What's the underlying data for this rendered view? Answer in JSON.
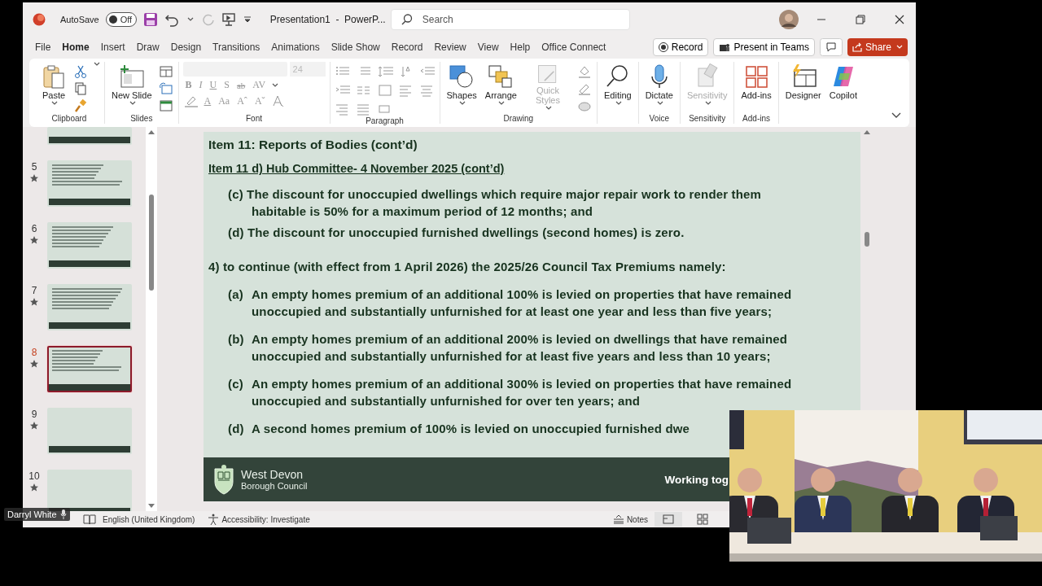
{
  "title_bar": {
    "autosave_label": "AutoSave",
    "autosave_toggle": {
      "label": "Off",
      "on": false
    },
    "document_title": "Presentation1  -  PowerP...",
    "search": {
      "placeholder": "Search"
    }
  },
  "tabs": [
    {
      "label": "File",
      "selected": false
    },
    {
      "label": "Home",
      "selected": true
    },
    {
      "label": "Insert",
      "selected": false
    },
    {
      "label": "Draw",
      "selected": false
    },
    {
      "label": "Design",
      "selected": false
    },
    {
      "label": "Transitions",
      "selected": false
    },
    {
      "label": "Animations",
      "selected": false
    },
    {
      "label": "Slide Show",
      "selected": false
    },
    {
      "label": "Record",
      "selected": false
    },
    {
      "label": "Review",
      "selected": false
    },
    {
      "label": "View",
      "selected": false
    },
    {
      "label": "Help",
      "selected": false
    },
    {
      "label": "Office Connect",
      "selected": false
    }
  ],
  "tab_actions": {
    "record": "Record",
    "present": "Present in Teams",
    "share": "Share"
  },
  "ribbon": {
    "clipboard": {
      "label": "Clipboard",
      "paste": "Paste"
    },
    "slides": {
      "label": "Slides",
      "new_slide": "New Slide"
    },
    "font": {
      "label": "Font",
      "size": {
        "value": "24",
        "disabled": true
      },
      "row_2": [
        "B",
        "I",
        "U",
        "S",
        "ab",
        "AV"
      ],
      "row_3": [
        "A",
        "Aa",
        "Aˆ",
        "Aˇ"
      ]
    },
    "paragraph": {
      "label": "Paragraph"
    },
    "drawing": {
      "label": "Drawing",
      "buttons": [
        {
          "label": "Shapes",
          "disabled": false
        },
        {
          "label": "Arrange",
          "disabled": false
        },
        {
          "label": "Quick Styles",
          "disabled": true
        }
      ]
    },
    "editing": {
      "button": "Editing"
    },
    "voice": {
      "label": "Voice",
      "button": {
        "label": "Dictate",
        "disabled": false
      }
    },
    "sensitivity": {
      "label": "Sensitivity",
      "button": {
        "label": "Sensitivity",
        "disabled": true
      }
    },
    "add_ins": {
      "label": "Add-ins",
      "button": "Add-ins"
    },
    "ai": {
      "buttons": [
        "Designer",
        "Copilot"
      ]
    }
  },
  "thumbnails": [
    {
      "kind": "partial",
      "selected": false
    },
    {
      "kind": "text",
      "number": "5",
      "selected": false
    },
    {
      "kind": "text",
      "number": "6",
      "selected": false
    },
    {
      "kind": "text",
      "number": "7",
      "selected": false
    },
    {
      "kind": "text",
      "number": "8",
      "selected": true
    },
    {
      "kind": "blank",
      "number": "9",
      "selected": false
    },
    {
      "kind": "blank",
      "number": "10",
      "selected": false
    }
  ],
  "slide": {
    "title": "Item 11: Reports of Bodies (cont’d)",
    "subtitle": "Item 11 d) Hub Committee- 4 November 2025 (cont’d)",
    "blocks": [
      {
        "kind": "sub",
        "text": "(c) The discount for unoccupied dwellings which require major repair work to render them habitable is 50% for a maximum period of 12 months; and"
      },
      {
        "kind": "sub",
        "text": "(d) The discount for unoccupied furnished dwellings (second homes) is zero."
      },
      {
        "kind": "heading",
        "text": "4) to continue (with effect from 1 April 2026) the 2025/26 Council Tax Premiums namely:"
      },
      {
        "kind": "item",
        "label": "(a)",
        "text": "An empty homes premium of an additional 100% is levied on properties that have remained unoccupied and substantially unfurnished for at least one year and less than five years;"
      },
      {
        "kind": "item",
        "label": "(b)",
        "text": "An empty homes premium of an additional 200% is levied on dwellings that have remained unoccupied and substantially unfurnished for at least five years and less than 10 years;"
      },
      {
        "kind": "item",
        "label": "(c)",
        "text": "An empty homes premium of an additional 300% is levied on properties that have remained unoccupied and substantially unfurnished for over ten years; and"
      },
      {
        "kind": "item",
        "label": "(d)",
        "text": "A second homes premium of 100% is levied on unoccupied furnished dwe"
      }
    ],
    "footer": {
      "org_name": "West Devon",
      "org_sub": "Borough Council",
      "tagline": "Working tog"
    }
  },
  "status_bar": {
    "language": "English (United Kingdom)",
    "accessibility": "Accessibility: Investigate",
    "notes": "Notes"
  },
  "speaker_label": "Darryl White"
}
